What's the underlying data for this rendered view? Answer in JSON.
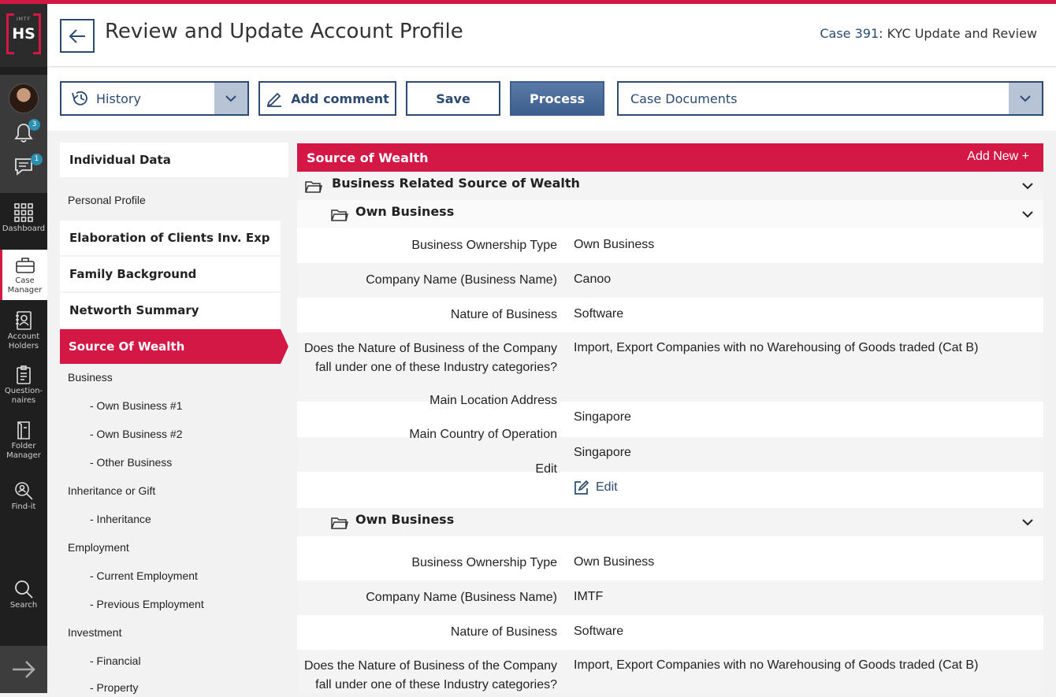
{
  "app": {
    "logo_small": "IMTF",
    "logo_main": "HS"
  },
  "rail": {
    "notifications_count": "3",
    "messages_count": "1",
    "items": [
      {
        "label": "Dashboard",
        "icon": "grid-icon"
      },
      {
        "label": "Case Manager",
        "icon": "briefcase-icon"
      },
      {
        "label": "Account Holders",
        "icon": "contacts-icon"
      },
      {
        "label": "Question-naires",
        "icon": "clipboard-icon"
      },
      {
        "label": "Folder Manager",
        "icon": "folder-icon"
      },
      {
        "label": "Find-it",
        "icon": "find-icon"
      },
      {
        "label": "Search",
        "icon": "search-icon"
      }
    ]
  },
  "header": {
    "title": "Review and Update Account Profile",
    "case_link": "Case 391",
    "case_desc": ": KYC Update and Review"
  },
  "toolbar": {
    "history_label": "History",
    "add_comment_label": "Add comment",
    "save_label": "Save",
    "process_label": "Process",
    "documents_label": "Case Documents"
  },
  "sections": {
    "individual_data": "Individual Data",
    "personal_profile": "Personal Profile",
    "elaboration": "Elaboration of Clients Inv. Exp",
    "family_background": "Family Background",
    "networth_summary": "Networth Summary",
    "source_of_wealth": "Source Of Wealth",
    "business": "Business",
    "own_business_1": "- Own Business #1",
    "own_business_2": "- Own Business #2",
    "other_business": "- Other Business",
    "inheritance_or_gift": "Inheritance or Gift",
    "inheritance": "- Inheritance",
    "employment": "Employment",
    "current_employment": "- Current Employment",
    "previous_employment": "- Previous Employment",
    "investment": "Investment",
    "financial": "- Financial",
    "property": "- Property"
  },
  "panel": {
    "title": "Source of Wealth",
    "add_new": "Add New +",
    "group_title": "Business Related Source of Wealth",
    "businesses": [
      {
        "title": "Own Business",
        "labels": {
          "ownership_type": "Business Ownership Type",
          "company_name": "Company Name (Business Name)",
          "nature": "Nature of Business",
          "industry_q1": "Does the Nature of Business of the Company",
          "industry_q2": "fall under one of these Industry categories?",
          "main_location": "Main Location Address",
          "main_country": "Main Country of Operation",
          "edit": "Edit"
        },
        "values": {
          "ownership_type": "Own Business",
          "company_name": "Canoo",
          "nature": "Software",
          "industry": "Import, Export Companies with no Warehousing of Goods traded (Cat B)",
          "main_location": "Singapore",
          "main_country": "Singapore",
          "edit_link": "Edit"
        }
      },
      {
        "title": "Own Business",
        "labels": {
          "ownership_type": "Business Ownership Type",
          "company_name": "Company Name (Business Name)",
          "nature": "Nature of Business",
          "industry_q1": "Does the Nature of Business of the Company",
          "industry_q2": "fall under one of these Industry categories?"
        },
        "values": {
          "ownership_type": "Own Business",
          "company_name": "IMTF",
          "nature": "Software",
          "industry": "Import, Export Companies with no Warehousing of Goods traded (Cat B)"
        }
      }
    ]
  },
  "colors": {
    "brand": "#d31846",
    "navy": "#2c4a72",
    "rail": "#1f1f1f"
  }
}
